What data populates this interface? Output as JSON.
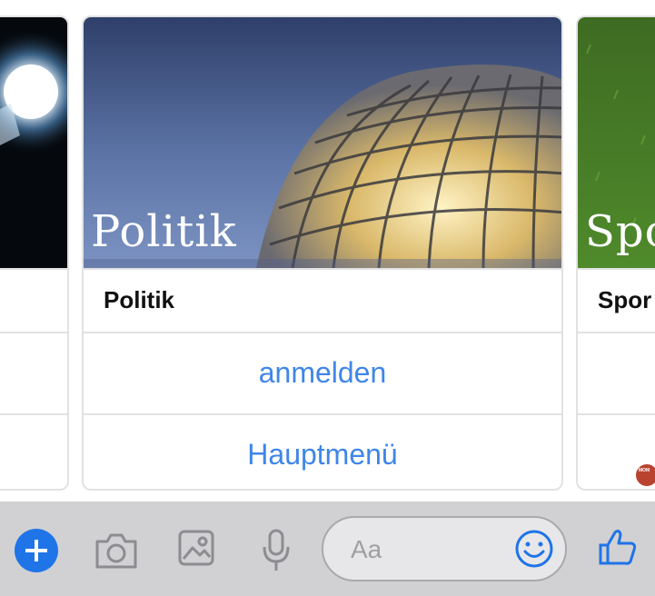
{
  "cards": {
    "left": {
      "title": ""
    },
    "main": {
      "hero_text": "Politik",
      "title": "Politik",
      "actions": [
        "anmelden",
        "Hauptmenü"
      ]
    },
    "right": {
      "hero_text": "Spo",
      "title": "Spor"
    }
  },
  "avatar": {
    "text": "MOM"
  },
  "composer": {
    "placeholder": "Aa"
  },
  "toolbar": {
    "icons": [
      "plus-icon",
      "camera-icon",
      "image-icon",
      "microphone-icon",
      "emoji-icon",
      "thumbs-up-icon"
    ]
  },
  "colors": {
    "accent": "#3f86e8",
    "plus_button": "#1f74e8",
    "toolbar_bg": "#d1d1d3",
    "card_border": "#e2e2e4"
  }
}
